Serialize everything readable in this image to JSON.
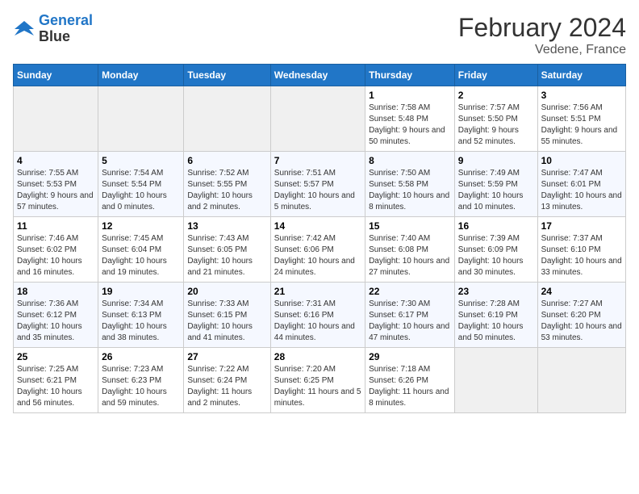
{
  "header": {
    "logo_line1": "General",
    "logo_line2": "Blue",
    "title": "February 2024",
    "subtitle": "Vedene, France"
  },
  "weekdays": [
    "Sunday",
    "Monday",
    "Tuesday",
    "Wednesday",
    "Thursday",
    "Friday",
    "Saturday"
  ],
  "weeks": [
    [
      {
        "empty": true
      },
      {
        "empty": true
      },
      {
        "empty": true
      },
      {
        "empty": true
      },
      {
        "day": 1,
        "sunrise": "7:58 AM",
        "sunset": "5:48 PM",
        "daylight": "9 hours and 50 minutes."
      },
      {
        "day": 2,
        "sunrise": "7:57 AM",
        "sunset": "5:50 PM",
        "daylight": "9 hours and 52 minutes."
      },
      {
        "day": 3,
        "sunrise": "7:56 AM",
        "sunset": "5:51 PM",
        "daylight": "9 hours and 55 minutes."
      }
    ],
    [
      {
        "day": 4,
        "sunrise": "7:55 AM",
        "sunset": "5:53 PM",
        "daylight": "9 hours and 57 minutes."
      },
      {
        "day": 5,
        "sunrise": "7:54 AM",
        "sunset": "5:54 PM",
        "daylight": "10 hours and 0 minutes."
      },
      {
        "day": 6,
        "sunrise": "7:52 AM",
        "sunset": "5:55 PM",
        "daylight": "10 hours and 2 minutes."
      },
      {
        "day": 7,
        "sunrise": "7:51 AM",
        "sunset": "5:57 PM",
        "daylight": "10 hours and 5 minutes."
      },
      {
        "day": 8,
        "sunrise": "7:50 AM",
        "sunset": "5:58 PM",
        "daylight": "10 hours and 8 minutes."
      },
      {
        "day": 9,
        "sunrise": "7:49 AM",
        "sunset": "5:59 PM",
        "daylight": "10 hours and 10 minutes."
      },
      {
        "day": 10,
        "sunrise": "7:47 AM",
        "sunset": "6:01 PM",
        "daylight": "10 hours and 13 minutes."
      }
    ],
    [
      {
        "day": 11,
        "sunrise": "7:46 AM",
        "sunset": "6:02 PM",
        "daylight": "10 hours and 16 minutes."
      },
      {
        "day": 12,
        "sunrise": "7:45 AM",
        "sunset": "6:04 PM",
        "daylight": "10 hours and 19 minutes."
      },
      {
        "day": 13,
        "sunrise": "7:43 AM",
        "sunset": "6:05 PM",
        "daylight": "10 hours and 21 minutes."
      },
      {
        "day": 14,
        "sunrise": "7:42 AM",
        "sunset": "6:06 PM",
        "daylight": "10 hours and 24 minutes."
      },
      {
        "day": 15,
        "sunrise": "7:40 AM",
        "sunset": "6:08 PM",
        "daylight": "10 hours and 27 minutes."
      },
      {
        "day": 16,
        "sunrise": "7:39 AM",
        "sunset": "6:09 PM",
        "daylight": "10 hours and 30 minutes."
      },
      {
        "day": 17,
        "sunrise": "7:37 AM",
        "sunset": "6:10 PM",
        "daylight": "10 hours and 33 minutes."
      }
    ],
    [
      {
        "day": 18,
        "sunrise": "7:36 AM",
        "sunset": "6:12 PM",
        "daylight": "10 hours and 35 minutes."
      },
      {
        "day": 19,
        "sunrise": "7:34 AM",
        "sunset": "6:13 PM",
        "daylight": "10 hours and 38 minutes."
      },
      {
        "day": 20,
        "sunrise": "7:33 AM",
        "sunset": "6:15 PM",
        "daylight": "10 hours and 41 minutes."
      },
      {
        "day": 21,
        "sunrise": "7:31 AM",
        "sunset": "6:16 PM",
        "daylight": "10 hours and 44 minutes."
      },
      {
        "day": 22,
        "sunrise": "7:30 AM",
        "sunset": "6:17 PM",
        "daylight": "10 hours and 47 minutes."
      },
      {
        "day": 23,
        "sunrise": "7:28 AM",
        "sunset": "6:19 PM",
        "daylight": "10 hours and 50 minutes."
      },
      {
        "day": 24,
        "sunrise": "7:27 AM",
        "sunset": "6:20 PM",
        "daylight": "10 hours and 53 minutes."
      }
    ],
    [
      {
        "day": 25,
        "sunrise": "7:25 AM",
        "sunset": "6:21 PM",
        "daylight": "10 hours and 56 minutes."
      },
      {
        "day": 26,
        "sunrise": "7:23 AM",
        "sunset": "6:23 PM",
        "daylight": "10 hours and 59 minutes."
      },
      {
        "day": 27,
        "sunrise": "7:22 AM",
        "sunset": "6:24 PM",
        "daylight": "11 hours and 2 minutes."
      },
      {
        "day": 28,
        "sunrise": "7:20 AM",
        "sunset": "6:25 PM",
        "daylight": "11 hours and 5 minutes."
      },
      {
        "day": 29,
        "sunrise": "7:18 AM",
        "sunset": "6:26 PM",
        "daylight": "11 hours and 8 minutes."
      },
      {
        "empty": true
      },
      {
        "empty": true
      }
    ]
  ]
}
